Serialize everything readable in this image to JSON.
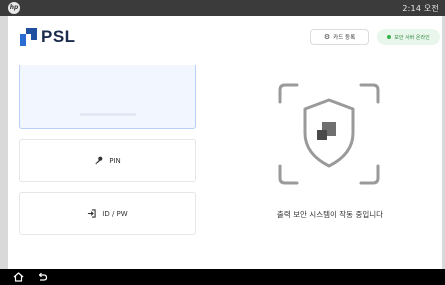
{
  "statusbar": {
    "logo": "hp",
    "time": "2:14 오전"
  },
  "header": {
    "logo_text": "PSL",
    "card_register_label": "카드 등록",
    "server_status_label": "보안 서버 온라인"
  },
  "auth_options": {
    "pin_label": "PIN",
    "idpw_label": "ID / PW"
  },
  "main": {
    "status_message": "출력 보안 시스템이 작동 중입니다"
  },
  "icons": {
    "gear": "gear-icon",
    "pin": "key-icon",
    "idpw": "login-icon",
    "shield": "shield-icon",
    "home": "home-icon",
    "back": "back-icon"
  },
  "colors": {
    "brand_dark": "#1a2b4c",
    "brand_blue": "#2b6cd4",
    "online_green": "#35b24a",
    "scan_gray": "#9a9a9a"
  }
}
